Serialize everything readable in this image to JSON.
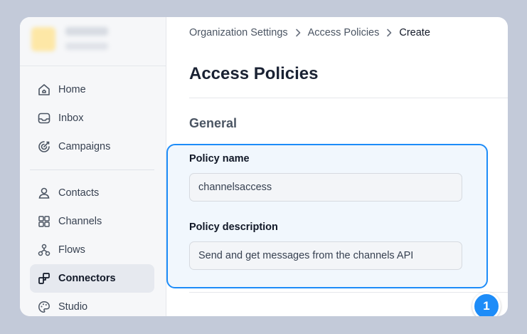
{
  "sidebar": {
    "items": [
      {
        "label": "Home",
        "icon": "home-icon"
      },
      {
        "label": "Inbox",
        "icon": "inbox-icon"
      },
      {
        "label": "Campaigns",
        "icon": "campaigns-icon"
      },
      {
        "label": "Contacts",
        "icon": "contacts-icon"
      },
      {
        "label": "Channels",
        "icon": "channels-icon"
      },
      {
        "label": "Flows",
        "icon": "flows-icon"
      },
      {
        "label": "Connectors",
        "icon": "connectors-icon",
        "active": true
      },
      {
        "label": "Studio",
        "icon": "studio-icon"
      }
    ]
  },
  "breadcrumb": {
    "items": [
      "Organization Settings",
      "Access Policies",
      "Create"
    ]
  },
  "page": {
    "title": "Access Policies",
    "section": "General"
  },
  "form": {
    "name_label": "Policy name",
    "name_value": "channelsaccess",
    "description_label": "Policy description",
    "description_value": "Send and get messages from the channels API"
  },
  "annotation": {
    "step": "1"
  },
  "colors": {
    "accent": "#1d8cf8",
    "background": "#c3cad9"
  }
}
